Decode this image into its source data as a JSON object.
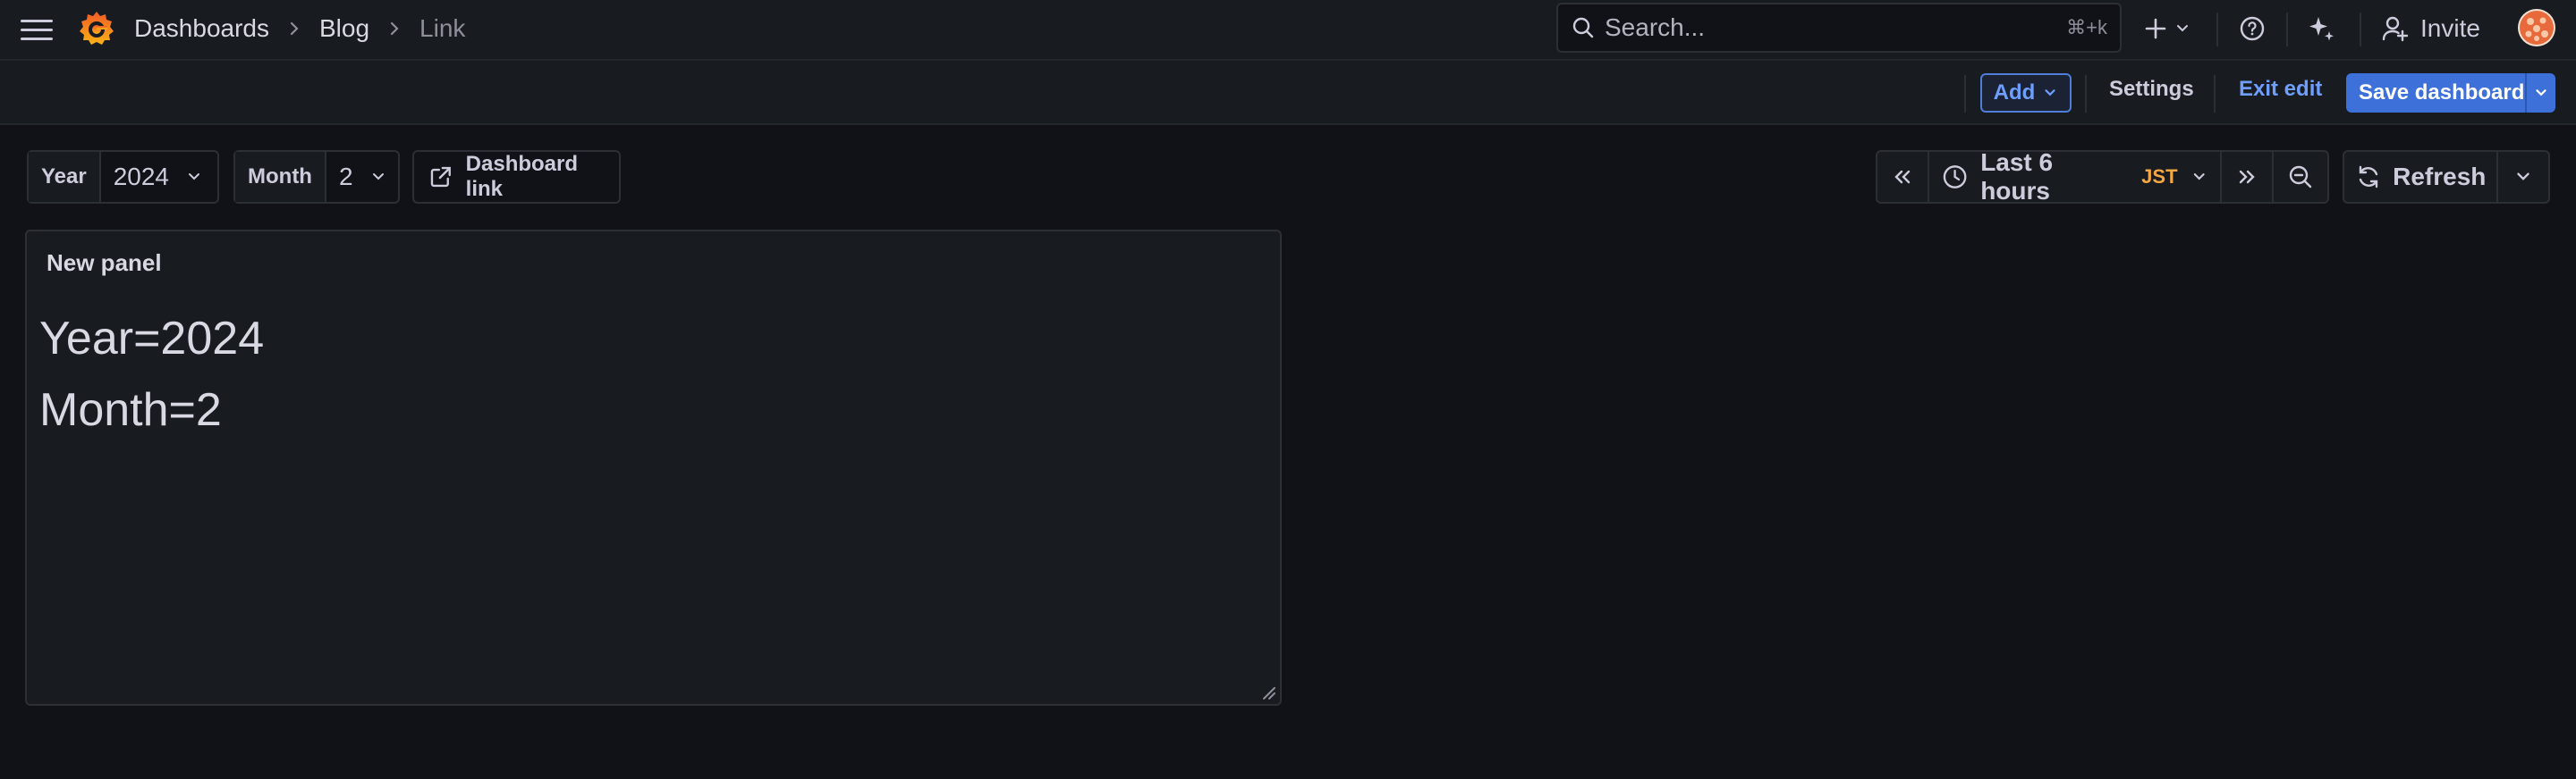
{
  "nav": {
    "breadcrumbs": [
      "Dashboards",
      "Blog",
      "Link"
    ],
    "search_placeholder": "Search...",
    "search_shortcut": "⌘+k",
    "invite_label": "Invite",
    "icons": [
      "menu-icon",
      "grafana-logo-icon",
      "search-icon",
      "plus-icon",
      "help-icon",
      "sparkle-icon",
      "invite-user-icon"
    ]
  },
  "toolbar": {
    "add_label": "Add",
    "settings_label": "Settings",
    "exit_edit_label": "Exit edit",
    "save_label": "Save dashboard"
  },
  "variables": {
    "year": {
      "label": "Year",
      "value": "2024"
    },
    "month": {
      "label": "Month",
      "value": "2"
    },
    "dashboard_link_label": "Dashboard link"
  },
  "time": {
    "range_label": "Last 6 hours",
    "timezone": "JST",
    "refresh_label": "Refresh"
  },
  "panel": {
    "title": "New panel",
    "lines": [
      "Year=2024",
      "Month=2"
    ]
  },
  "colors": {
    "background": "#111217",
    "surface": "#181b1f",
    "primary": "#3d71d9",
    "link": "#6e9fff",
    "timezone": "#f5a742",
    "logo": "#f46800"
  }
}
